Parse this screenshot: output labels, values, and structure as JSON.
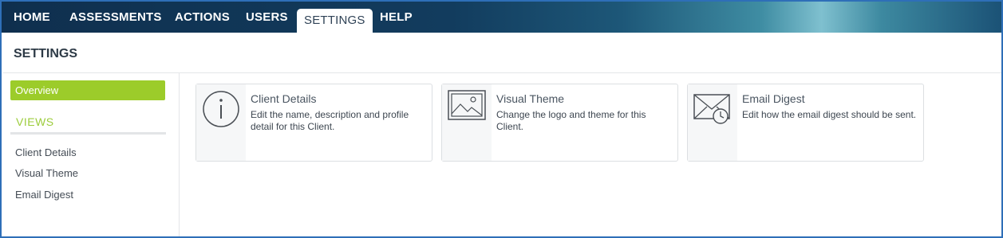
{
  "nav": {
    "items": [
      {
        "label": "HOME"
      },
      {
        "label": "ASSESSMENTS"
      },
      {
        "label": "ACTIONS"
      },
      {
        "label": "USERS"
      },
      {
        "label": "SETTINGS",
        "active": true
      },
      {
        "label": "HELP"
      }
    ]
  },
  "page": {
    "title": "SETTINGS"
  },
  "sidebar": {
    "overview_label": "Overview",
    "section_label": "VIEWS",
    "links": [
      "Client Details",
      "Visual Theme",
      "Email Digest"
    ]
  },
  "cards": [
    {
      "icon": "info-icon",
      "title": "Client Details",
      "description": "Edit the name, description and profile detail for this Client."
    },
    {
      "icon": "image-icon",
      "title": "Visual Theme",
      "description": "Change the logo and theme for this Client."
    },
    {
      "icon": "email-clock-icon",
      "title": "Email Digest",
      "description": "Edit how the email digest should be sent."
    }
  ],
  "colors": {
    "accent_green": "#9ccc2a",
    "nav_dark": "#123c5e",
    "frame_border": "#2e6fb8"
  }
}
